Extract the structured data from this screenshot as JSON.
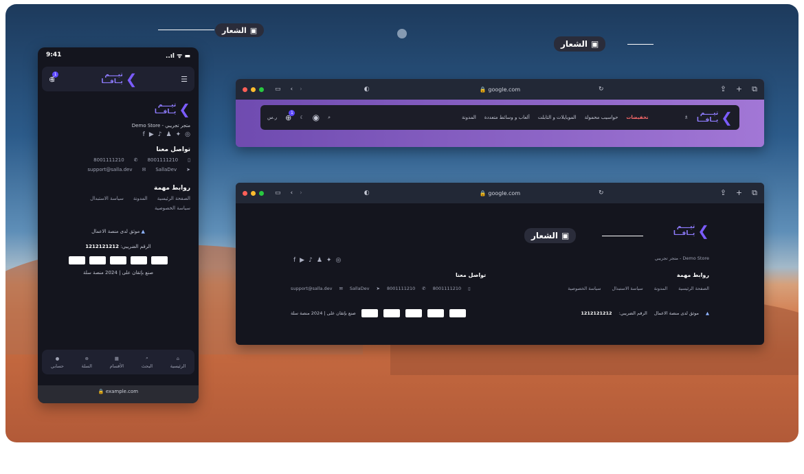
{
  "callout": {
    "logo_label": "الشعار"
  },
  "phone": {
    "time": "9:41",
    "status_icons": "..ıl ᯤ ▬",
    "logo": {
      "line1": "تيــــم",
      "line2": "يــافـــا"
    },
    "cart_count": "1",
    "store_name": "متجر تجريبي - Demo Store",
    "contact_title": "تواصل معنا",
    "phone1": "8001111210",
    "phone2": "8001111210",
    "email": "support@salla.dev",
    "social_handle": "SallaDev",
    "links_title": "روابط مهمة",
    "links": [
      "الصفحة الرئيسية",
      "المدونة",
      "سياسة الاستبدال",
      "سياسة الخصوصية"
    ],
    "trust_text": "موثق لدى منصة الاعمال",
    "tax_label": "الرقم الضريبي:",
    "tax_number": "1212121212",
    "copyright": "صنع بإتقان على | 2024 منصة سلة",
    "tabs": [
      "الرئيسية",
      "البحث",
      "الأقسام",
      "السلة",
      "حسابي"
    ],
    "url": "example.com"
  },
  "browser_top": {
    "url": "google.com",
    "nav": {
      "sale": "تخفيضات",
      "items": [
        "حواسيب محمولة",
        "الموبايلات و التابلت",
        "ألعاب و وسائط متعددة",
        "المدونة"
      ],
      "currency": "ر.س"
    }
  },
  "browser_bottom": {
    "url": "google.com",
    "store_name": "متجر تجريبي - Demo Store",
    "links_title": "روابط مهمة",
    "links": [
      "الصفحة الرئيسية",
      "المدونة",
      "سياسة الاستبدال",
      "سياسة الخصوصية"
    ],
    "contact_title": "تواصل معنا",
    "phone1": "8001111210",
    "phone2": "8001111210",
    "social_handle": "SallaDev",
    "email": "support@salla.dev",
    "trust_text": "موثق لدى منصة الاعمال",
    "tax_label": "الرقم الضريبي:",
    "tax_number": "1212121212",
    "copyright": "صنع بإتقان على | 2024 منصة سلة"
  }
}
